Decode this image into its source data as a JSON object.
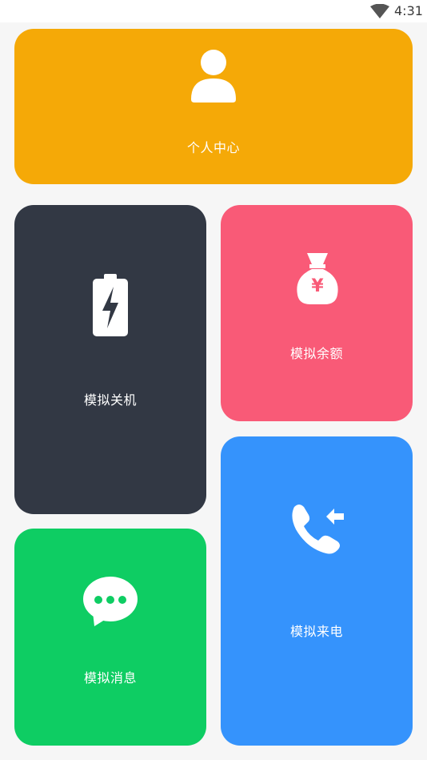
{
  "status_bar": {
    "time": "4:31",
    "wifi_icon": "wifi-icon"
  },
  "cards": {
    "profile": {
      "label": "个人中心",
      "color": "#f5a907",
      "icon": "person-icon"
    },
    "shutdown": {
      "label": "模拟关机",
      "color": "#323844",
      "icon": "battery-charging-icon"
    },
    "balance": {
      "label": "模拟余额",
      "color": "#f95a77",
      "icon": "money-bag-icon"
    },
    "call": {
      "label": "模拟来电",
      "color": "#3593fc",
      "icon": "incoming-call-icon"
    },
    "message": {
      "label": "模拟消息",
      "color": "#0ecd63",
      "icon": "chat-bubble-icon"
    }
  }
}
